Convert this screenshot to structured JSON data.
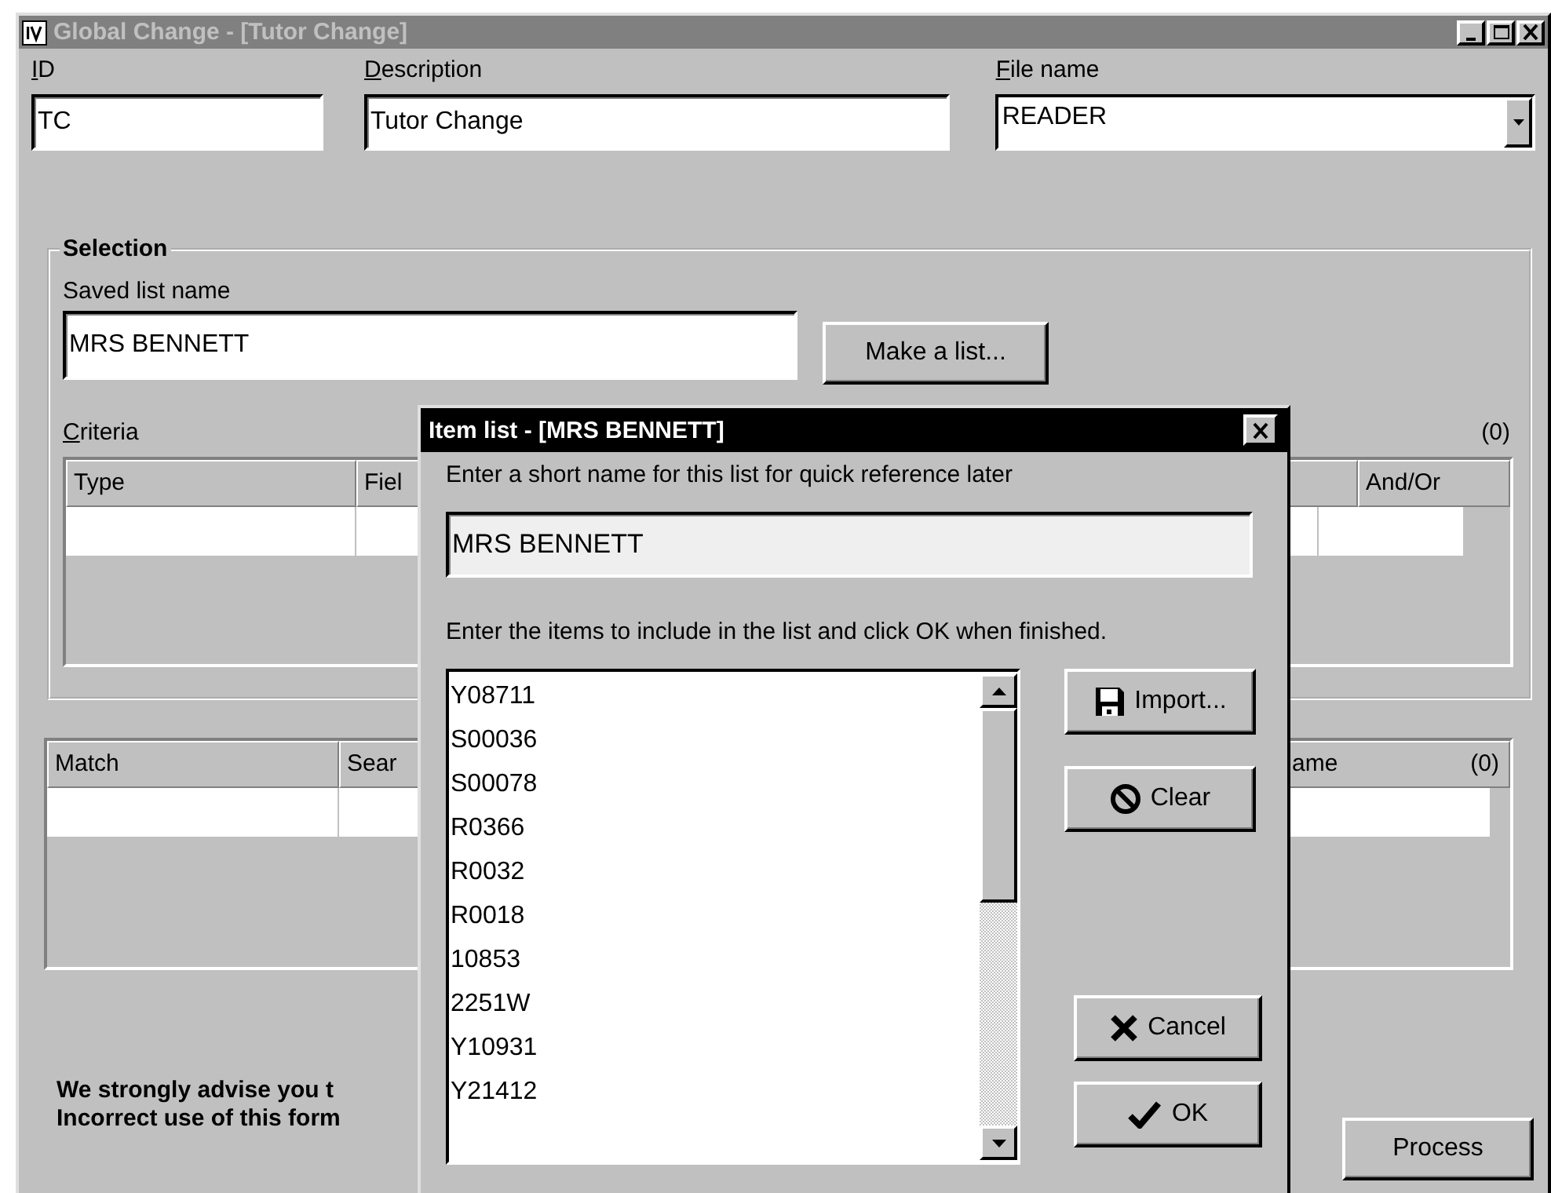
{
  "window": {
    "title": "Global Change - [Tutor Change]",
    "active": false
  },
  "fields": [
    {
      "label": "ID",
      "value": "TC",
      "kind": "text"
    },
    {
      "label": "Description",
      "value": "Tutor Change",
      "kind": "text"
    },
    {
      "label": "File name",
      "value": "READER",
      "kind": "dropdown"
    }
  ],
  "selection": {
    "legend": "Selection",
    "saved_list_label": "Saved list name",
    "saved_list_value": "MRS BENNETT",
    "make_list_button": "Make a list...",
    "criteria_label": "Criteria",
    "criteria_count": "(0)",
    "criteria_columns": [
      "Type",
      "Fiel",
      "And/Or"
    ]
  },
  "results": {
    "columns": [
      "Match",
      "Sear",
      "ame"
    ],
    "count": "(0)"
  },
  "warning": [
    "We strongly advise you t",
    "Incorrect use of this form"
  ],
  "process_button": "Process",
  "dialog": {
    "title": "Item list - [MRS BENNETT]",
    "active": true,
    "name_prompt": "Enter a short name for this list for quick reference later",
    "name_value": "MRS BENNETT",
    "items_prompt": "Enter the items to include in the list and click OK when finished.",
    "items": [
      "Y08711",
      "S00036",
      "S00078",
      "R0366",
      "R0032",
      "R0018",
      "10853",
      "2251W",
      "Y10931",
      "Y21412"
    ],
    "buttons": [
      {
        "label": "Import..."
      },
      {
        "label": "Clear"
      },
      {
        "label": "Cancel"
      },
      {
        "label": "OK"
      }
    ]
  }
}
